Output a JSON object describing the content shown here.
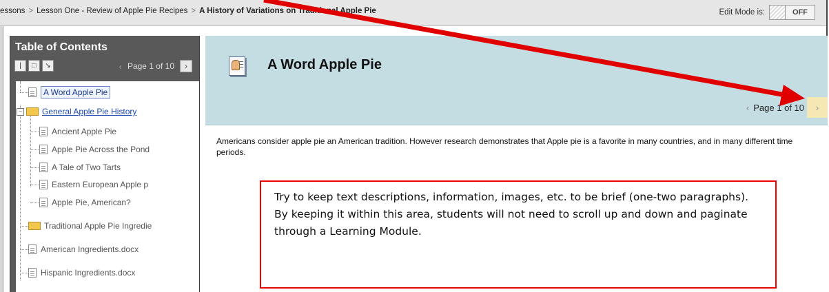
{
  "breadcrumb": {
    "items": [
      "essons",
      "Lesson One - Review of Apple Pie Recipes",
      "A History of Variations on Traditional Apple Pie"
    ],
    "separator": ">"
  },
  "edit_mode": {
    "label": "Edit Mode is:",
    "state": "OFF"
  },
  "toc": {
    "title": "Table of Contents",
    "page_label": "Page 1 of 10",
    "items": [
      {
        "label": "A Word Apple Pie",
        "icon": "document-icon"
      },
      {
        "label": "General Apple Pie History",
        "icon": "folder-icon"
      },
      {
        "label": "Ancient Apple Pie",
        "icon": "document-icon"
      },
      {
        "label": "Apple Pie Across the Pond",
        "icon": "document-icon"
      },
      {
        "label": "A Tale of Two Tarts",
        "icon": "document-icon"
      },
      {
        "label": "Eastern European Apple p",
        "icon": "document-icon"
      },
      {
        "label": "Apple Pie, American?",
        "icon": "document-icon"
      },
      {
        "label": "Traditional Apple Pie Ingredie",
        "icon": "folder-icon"
      },
      {
        "label": "American Ingredients.docx",
        "icon": "document-icon"
      },
      {
        "label": "Hispanic Ingredients.docx",
        "icon": "document-icon"
      }
    ]
  },
  "content": {
    "title": "A Word Apple Pie",
    "page_label": "Page 1 of 10",
    "body": "Americans consider apple pie an American tradition.  However research demonstrates that Apple pie is a favorite in many countries, and in many different time periods."
  },
  "note": {
    "text": "Try to keep text descriptions, information, images, etc. to be brief (one-two paragraphs).   By keeping it within this area, students will not need to scroll up and down and paginate through a Learning Module."
  },
  "colors": {
    "annotation_red": "#e00000",
    "header_bg": "#c4dde3",
    "toc_bg": "#595959",
    "next_button_bg": "#f5e8b5"
  }
}
